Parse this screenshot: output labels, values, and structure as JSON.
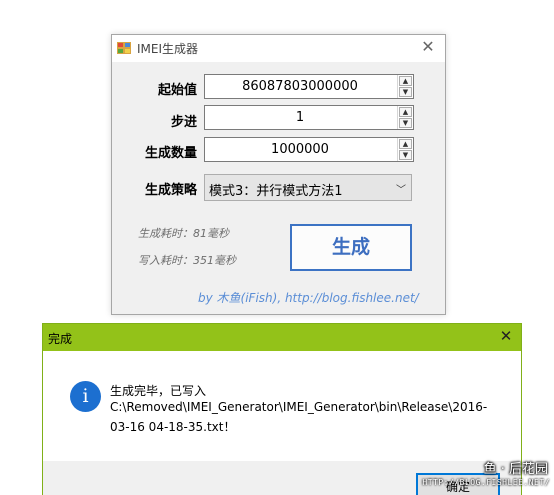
{
  "main_window": {
    "title": "IMEI生成器",
    "close_glyph": "✕",
    "fields": {
      "start_label": "起始值",
      "start_value": "86087803000000",
      "step_label": "步进",
      "step_value": "1",
      "count_label": "生成数量",
      "count_value": "1000000",
      "strategy_label": "生成策略",
      "strategy_value": "模式3：并行模式方法1"
    },
    "stats": {
      "gen_time": "生成耗时：81毫秒",
      "write_time": "写入耗时：351毫秒"
    },
    "generate_button": "生成",
    "credit": "by 木鱼(iFish), http://blog.fishlee.net/"
  },
  "message_box": {
    "title": "完成",
    "close_glyph": "✕",
    "icon_glyph": "i",
    "message_line1": "生成完毕，已写入",
    "message_line2": "C:\\Removed\\IMEI_Generator\\IMEI_Generator\\bin\\Release\\2016-",
    "message_line3": "03-16 04-18-35.txt！",
    "ok_button": "确定"
  },
  "watermark": {
    "line1": "鱼 · 后花园",
    "line2": "HTTP://BLOG.FISHLEE.NET/"
  },
  "colors": {
    "accent_blue": "#3d6ec0",
    "msg_titlebar": "#93c219",
    "info_icon": "#1c6fd0"
  }
}
